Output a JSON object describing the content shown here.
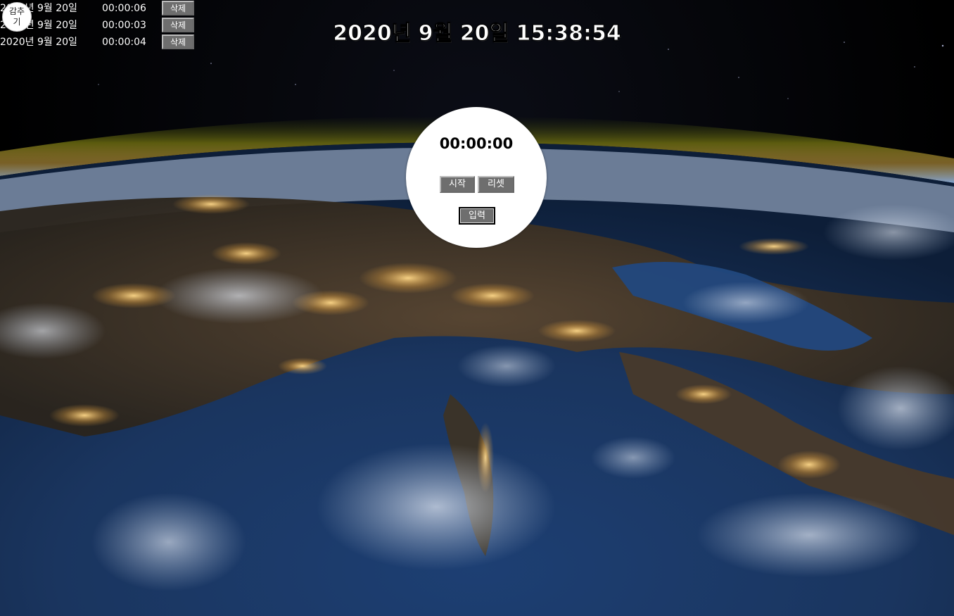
{
  "clock": {
    "text": "2020년 9월 20일 15:38:54"
  },
  "collapse_button": {
    "label": "감추기"
  },
  "records": [
    {
      "date": "2020년 9월 20일",
      "time": "00:00:06",
      "delete_label": "삭제"
    },
    {
      "date": "2020년 9월 20일",
      "time": "00:00:03",
      "delete_label": "삭제"
    },
    {
      "date": "2020년 9월 20일",
      "time": "00:00:04",
      "delete_label": "삭제"
    }
  ],
  "stopwatch": {
    "display": "00:00:00",
    "start_label": "시작",
    "reset_label": "리셋",
    "input_label": "입력"
  },
  "colors": {
    "button_gray": "#6e6e6e",
    "circle_white": "#ffffff",
    "text_white": "#ffffff"
  }
}
